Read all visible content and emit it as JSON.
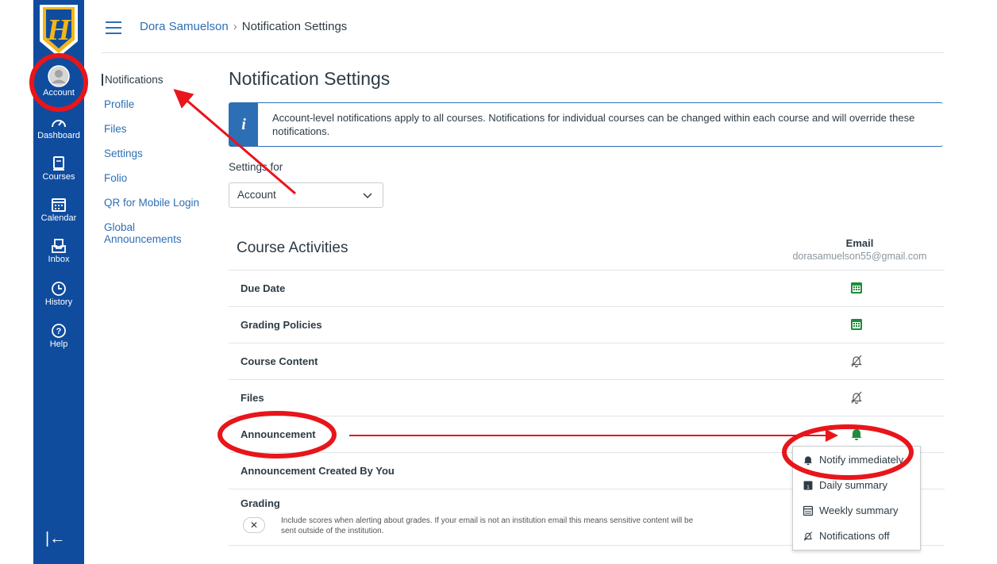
{
  "global_nav": {
    "items": [
      {
        "label": "Account",
        "icon": "account-icon"
      },
      {
        "label": "Dashboard",
        "icon": "dashboard-icon"
      },
      {
        "label": "Courses",
        "icon": "courses-icon"
      },
      {
        "label": "Calendar",
        "icon": "calendar-icon"
      },
      {
        "label": "Inbox",
        "icon": "inbox-icon"
      },
      {
        "label": "History",
        "icon": "history-icon"
      },
      {
        "label": "Help",
        "icon": "help-icon"
      }
    ],
    "collapse_icon": "collapse-nav-icon",
    "brand_color": "#0f4c9e",
    "logo_letter": "H"
  },
  "breadcrumb": {
    "user": "Dora Samuelson",
    "separator": "›",
    "current": "Notification Settings"
  },
  "subnav": {
    "items": [
      "Notifications",
      "Profile",
      "Files",
      "Settings",
      "Folio",
      "QR for Mobile Login",
      "Global Announcements"
    ],
    "active": "Notifications"
  },
  "page": {
    "title": "Notification Settings",
    "alert": "Account-level notifications apply to all courses. Notifications for individual courses can be changed within each course and will override these notifications.",
    "settings_for_label": "Settings for",
    "settings_for_value": "Account"
  },
  "section": {
    "title": "Course Activities",
    "email_header": "Email",
    "email_address": "dorasamuelson55@gmail.com"
  },
  "rows": [
    {
      "name": "Due Date",
      "state": "daily-summary-icon"
    },
    {
      "name": "Grading Policies",
      "state": "daily-summary-icon"
    },
    {
      "name": "Course Content",
      "state": "notifications-off-icon"
    },
    {
      "name": "Files",
      "state": "notifications-off-icon"
    },
    {
      "name": "Announcement",
      "state": "notify-immediately-icon"
    },
    {
      "name": "Announcement Created By You",
      "state": ""
    },
    {
      "name": "Grading",
      "state": ""
    }
  ],
  "grading": {
    "toggle": "✕",
    "description": "Include scores when alerting about grades. If your email is not an institution email this means sensitive content will be sent outside of the institution."
  },
  "menu_options": [
    "Notify immediately",
    "Daily summary",
    "Weekly summary",
    "Notifications off"
  ],
  "colors": {
    "link": "#2d6fb5",
    "green": "#1e8c3a",
    "annotation": "#e8151a"
  }
}
